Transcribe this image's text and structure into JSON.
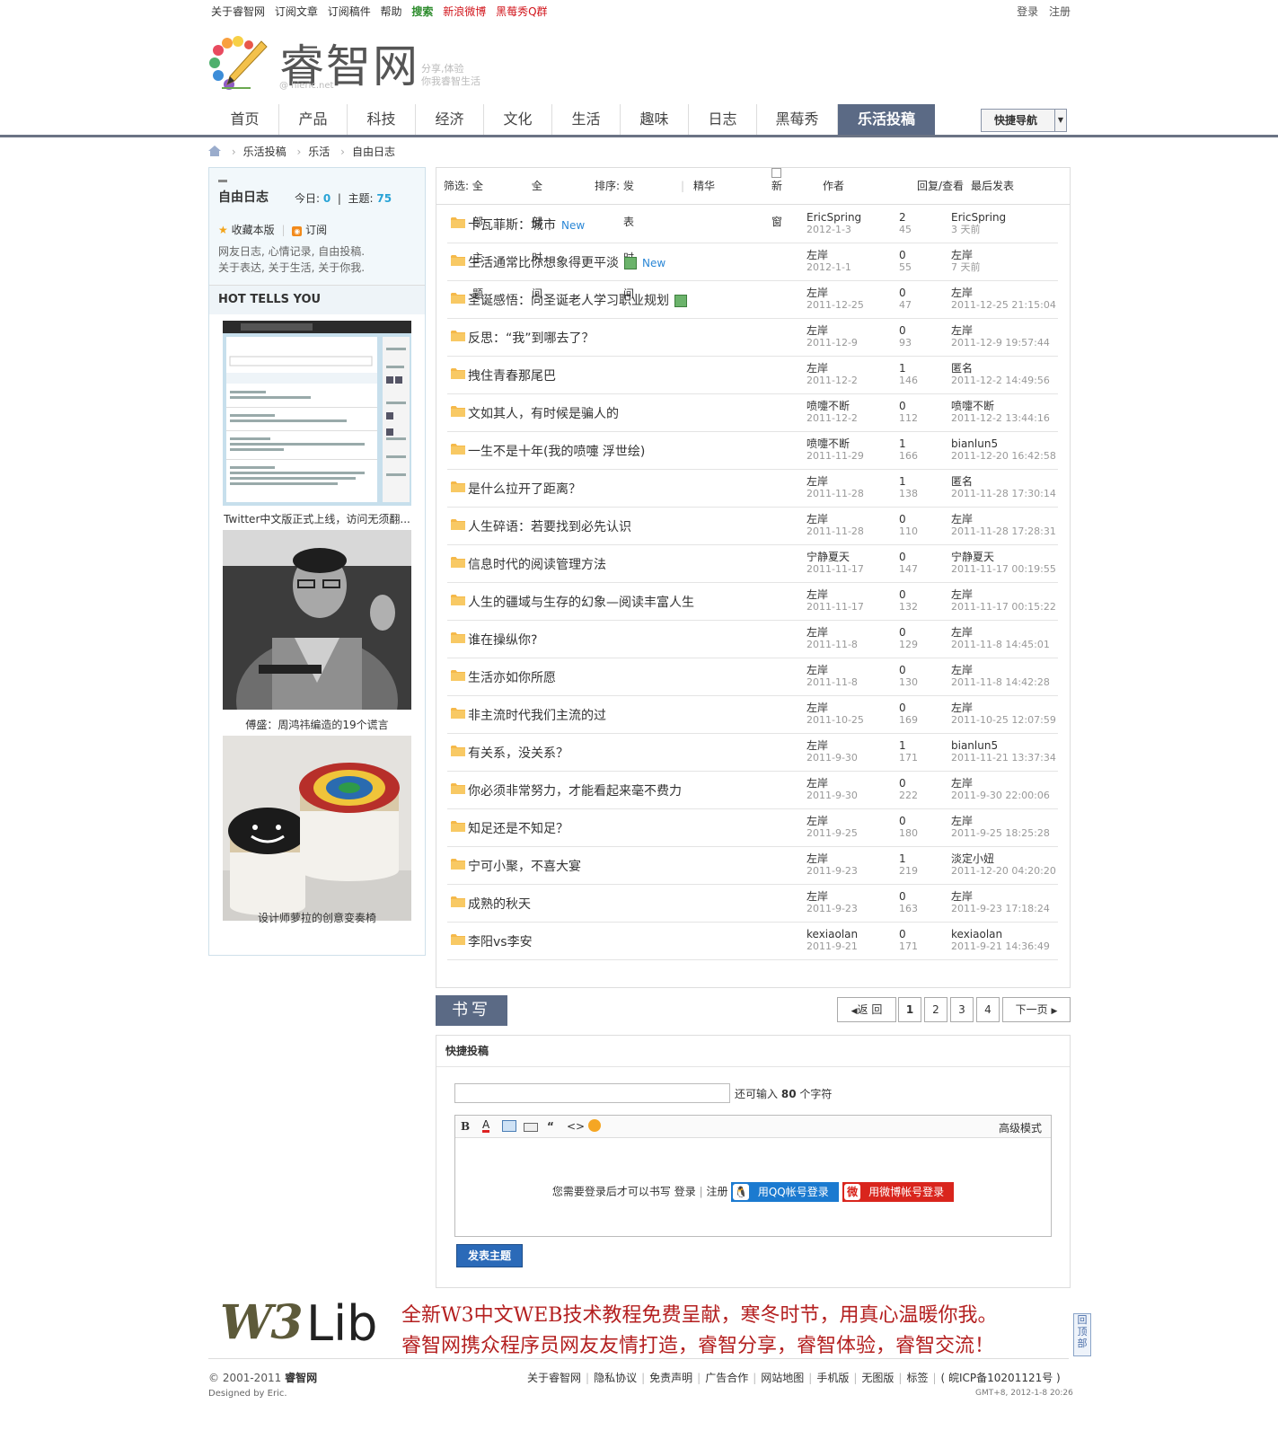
{
  "topbar": {
    "links": [
      "关于睿智网",
      "订阅文章",
      "订阅稿件",
      "帮助"
    ],
    "search": "搜索",
    "weibo": "新浪微博",
    "qqgroup": "黑莓秀Q群",
    "login": "登录",
    "register": "注册"
  },
  "logo": {
    "name": "睿智网",
    "domain": "@ hieric.net",
    "slogan1": "分享,体验",
    "slogan2": "你我睿智生活"
  },
  "nav": {
    "items": [
      "首页",
      "产品",
      "科技",
      "经济",
      "文化",
      "生活",
      "趣味",
      "日志",
      "黑莓秀",
      "乐活投稿"
    ],
    "active_index": 9,
    "quick": "快捷导航"
  },
  "breadcrumb": [
    "乐活投稿",
    "乐活",
    "自由日志"
  ],
  "sidebar": {
    "forum_title": "自由日志",
    "today_label": "今日:",
    "today_value": "0",
    "topics_label": "主题:",
    "topics_value": "75",
    "favorite": "收藏本版",
    "subscribe": "订阅",
    "desc1": "网友日志, 心情记录, 自由投稿.",
    "desc2": "关于表达, 关于生活, 关于你我.",
    "hot_title": "HOT TELLS YOU",
    "captions": [
      "Twitter中文版正式上线，访问无须翻...",
      "傅盛：周鸿祎编造的19个谎言",
      "设计师萝拉的创意变奏椅"
    ]
  },
  "filter": {
    "screen": "筛选:",
    "all_topics": "全部主题",
    "all_time": "全部时间",
    "sort": "排序:",
    "sort_by": "发表时间",
    "digest": "精华",
    "new_window": "新窗",
    "author": "作者",
    "reply_view": "回复/查看",
    "last_post": "最后发表"
  },
  "threads": [
    {
      "title": "卡瓦菲斯：城市",
      "new": "New",
      "img": false,
      "author": "EricSpring",
      "date": "2012-1-3",
      "replies": "2",
      "views": "45",
      "last_user": "EricSpring",
      "last_time": "3 天前"
    },
    {
      "title": "生活通常比你想象得更平淡",
      "new": "New",
      "img": true,
      "author": "左岸",
      "date": "2012-1-1",
      "replies": "0",
      "views": "55",
      "last_user": "左岸",
      "last_time": "7 天前"
    },
    {
      "title": "圣诞感悟：向圣诞老人学习职业规划",
      "new": "",
      "img": true,
      "author": "左岸",
      "date": "2011-12-25",
      "replies": "0",
      "views": "47",
      "last_user": "左岸",
      "last_time": "2011-12-25 21:15:04"
    },
    {
      "title": "反思：“我”到哪去了？",
      "new": "",
      "img": false,
      "author": "左岸",
      "date": "2011-12-9",
      "replies": "0",
      "views": "93",
      "last_user": "左岸",
      "last_time": "2011-12-9 19:57:44"
    },
    {
      "title": "拽住青春那尾巴",
      "new": "",
      "img": false,
      "author": "左岸",
      "date": "2011-12-2",
      "replies": "1",
      "views": "146",
      "last_user": "匿名",
      "last_time": "2011-12-2 14:49:56"
    },
    {
      "title": "文如其人，有时候是骗人的",
      "new": "",
      "img": false,
      "author": "喷嚏不断",
      "date": "2011-12-2",
      "replies": "0",
      "views": "112",
      "last_user": "喷嚏不断",
      "last_time": "2011-12-2 13:44:16"
    },
    {
      "title": "一生不是十年(我的喷嚏 浮世绘)",
      "new": "",
      "img": false,
      "author": "喷嚏不断",
      "date": "2011-11-29",
      "replies": "1",
      "views": "166",
      "last_user": "bianlun5",
      "last_time": "2011-12-20 16:42:58"
    },
    {
      "title": "是什么拉开了距离？",
      "new": "",
      "img": false,
      "author": "左岸",
      "date": "2011-11-28",
      "replies": "1",
      "views": "138",
      "last_user": "匿名",
      "last_time": "2011-11-28 17:30:14"
    },
    {
      "title": "人生碎语：若要找到必先认识",
      "new": "",
      "img": false,
      "author": "左岸",
      "date": "2011-11-28",
      "replies": "0",
      "views": "110",
      "last_user": "左岸",
      "last_time": "2011-11-28 17:28:31"
    },
    {
      "title": "信息时代的阅读管理方法",
      "new": "",
      "img": false,
      "author": "宁静夏天",
      "date": "2011-11-17",
      "replies": "0",
      "views": "147",
      "last_user": "宁静夏天",
      "last_time": "2011-11-17 00:19:55"
    },
    {
      "title": "人生的疆域与生存的幻象—阅读丰富人生",
      "new": "",
      "img": false,
      "author": "左岸",
      "date": "2011-11-17",
      "replies": "0",
      "views": "132",
      "last_user": "左岸",
      "last_time": "2011-11-17 00:15:22"
    },
    {
      "title": "谁在操纵你?",
      "new": "",
      "img": false,
      "author": "左岸",
      "date": "2011-11-8",
      "replies": "0",
      "views": "129",
      "last_user": "左岸",
      "last_time": "2011-11-8 14:45:01"
    },
    {
      "title": "生活亦如你所愿",
      "new": "",
      "img": false,
      "author": "左岸",
      "date": "2011-11-8",
      "replies": "0",
      "views": "130",
      "last_user": "左岸",
      "last_time": "2011-11-8 14:42:28"
    },
    {
      "title": "非主流时代我们主流的过",
      "new": "",
      "img": false,
      "author": "左岸",
      "date": "2011-10-25",
      "replies": "0",
      "views": "169",
      "last_user": "左岸",
      "last_time": "2011-10-25 12:07:59"
    },
    {
      "title": "有关系，没关系？",
      "new": "",
      "img": false,
      "author": "左岸",
      "date": "2011-9-30",
      "replies": "1",
      "views": "171",
      "last_user": "bianlun5",
      "last_time": "2011-11-21 13:37:34"
    },
    {
      "title": "你必须非常努力，才能看起来毫不费力",
      "new": "",
      "img": false,
      "author": "左岸",
      "date": "2011-9-30",
      "replies": "0",
      "views": "222",
      "last_user": "左岸",
      "last_time": "2011-9-30 22:00:06"
    },
    {
      "title": "知足还是不知足？",
      "new": "",
      "img": false,
      "author": "左岸",
      "date": "2011-9-25",
      "replies": "0",
      "views": "180",
      "last_user": "左岸",
      "last_time": "2011-9-25 18:25:28"
    },
    {
      "title": "宁可小聚，不喜大宴",
      "new": "",
      "img": false,
      "author": "左岸",
      "date": "2011-9-23",
      "replies": "1",
      "views": "219",
      "last_user": "淡定小妞",
      "last_time": "2011-12-20 04:20:20"
    },
    {
      "title": "成熟的秋天",
      "new": "",
      "img": false,
      "author": "左岸",
      "date": "2011-9-23",
      "replies": "0",
      "views": "163",
      "last_user": "左岸",
      "last_time": "2011-9-23 17:18:24"
    },
    {
      "title": "李阳vs李安",
      "new": "",
      "img": false,
      "author": "kexiaolan",
      "date": "2011-9-21",
      "replies": "0",
      "views": "171",
      "last_user": "kexiaolan",
      "last_time": "2011-9-21 14:36:49"
    }
  ],
  "write_button": "书写",
  "pager": {
    "back": "返 回",
    "pages": [
      "1",
      "2",
      "3",
      "4"
    ],
    "next": "下一页"
  },
  "quickpost": {
    "title": "快捷投稿",
    "remain_prefix": "还可输入",
    "remain_count": "80",
    "remain_suffix": "个字符",
    "advanced": "高级模式",
    "login_note": "您需要登录后才可以书写",
    "login": "登录",
    "register": "注册",
    "qq_login": "用QQ帐号登录",
    "weibo_login": "用微博帐号登录",
    "submit": "发表主题"
  },
  "banner": {
    "w3": "W3",
    "lib": "Lib",
    "line1": "全新W3中文WEB技术教程免费呈献，寒冬时节，用真心温暖你我。",
    "line2": "睿智网携众程序员网友友情打造，睿智分享，睿智体验，睿智交流！"
  },
  "gotop": "回顶部",
  "footer": {
    "copyright": "© 2001-2011",
    "site": "睿智网",
    "designed": "Designed by Eric.",
    "links": [
      "关于睿智网",
      "隐私协议",
      "免责声明",
      "广告合作",
      "网站地图",
      "手机版",
      "无图版",
      "标签",
      "( 皖ICP备10201121号 )"
    ],
    "gmt": "GMT+8, 2012-1-8 20:26"
  },
  "colors": {
    "nav_active": "#5b6a85",
    "accent_blue": "#28a3d6",
    "banner_red": "#b42020",
    "folder": "#f5b94a"
  }
}
